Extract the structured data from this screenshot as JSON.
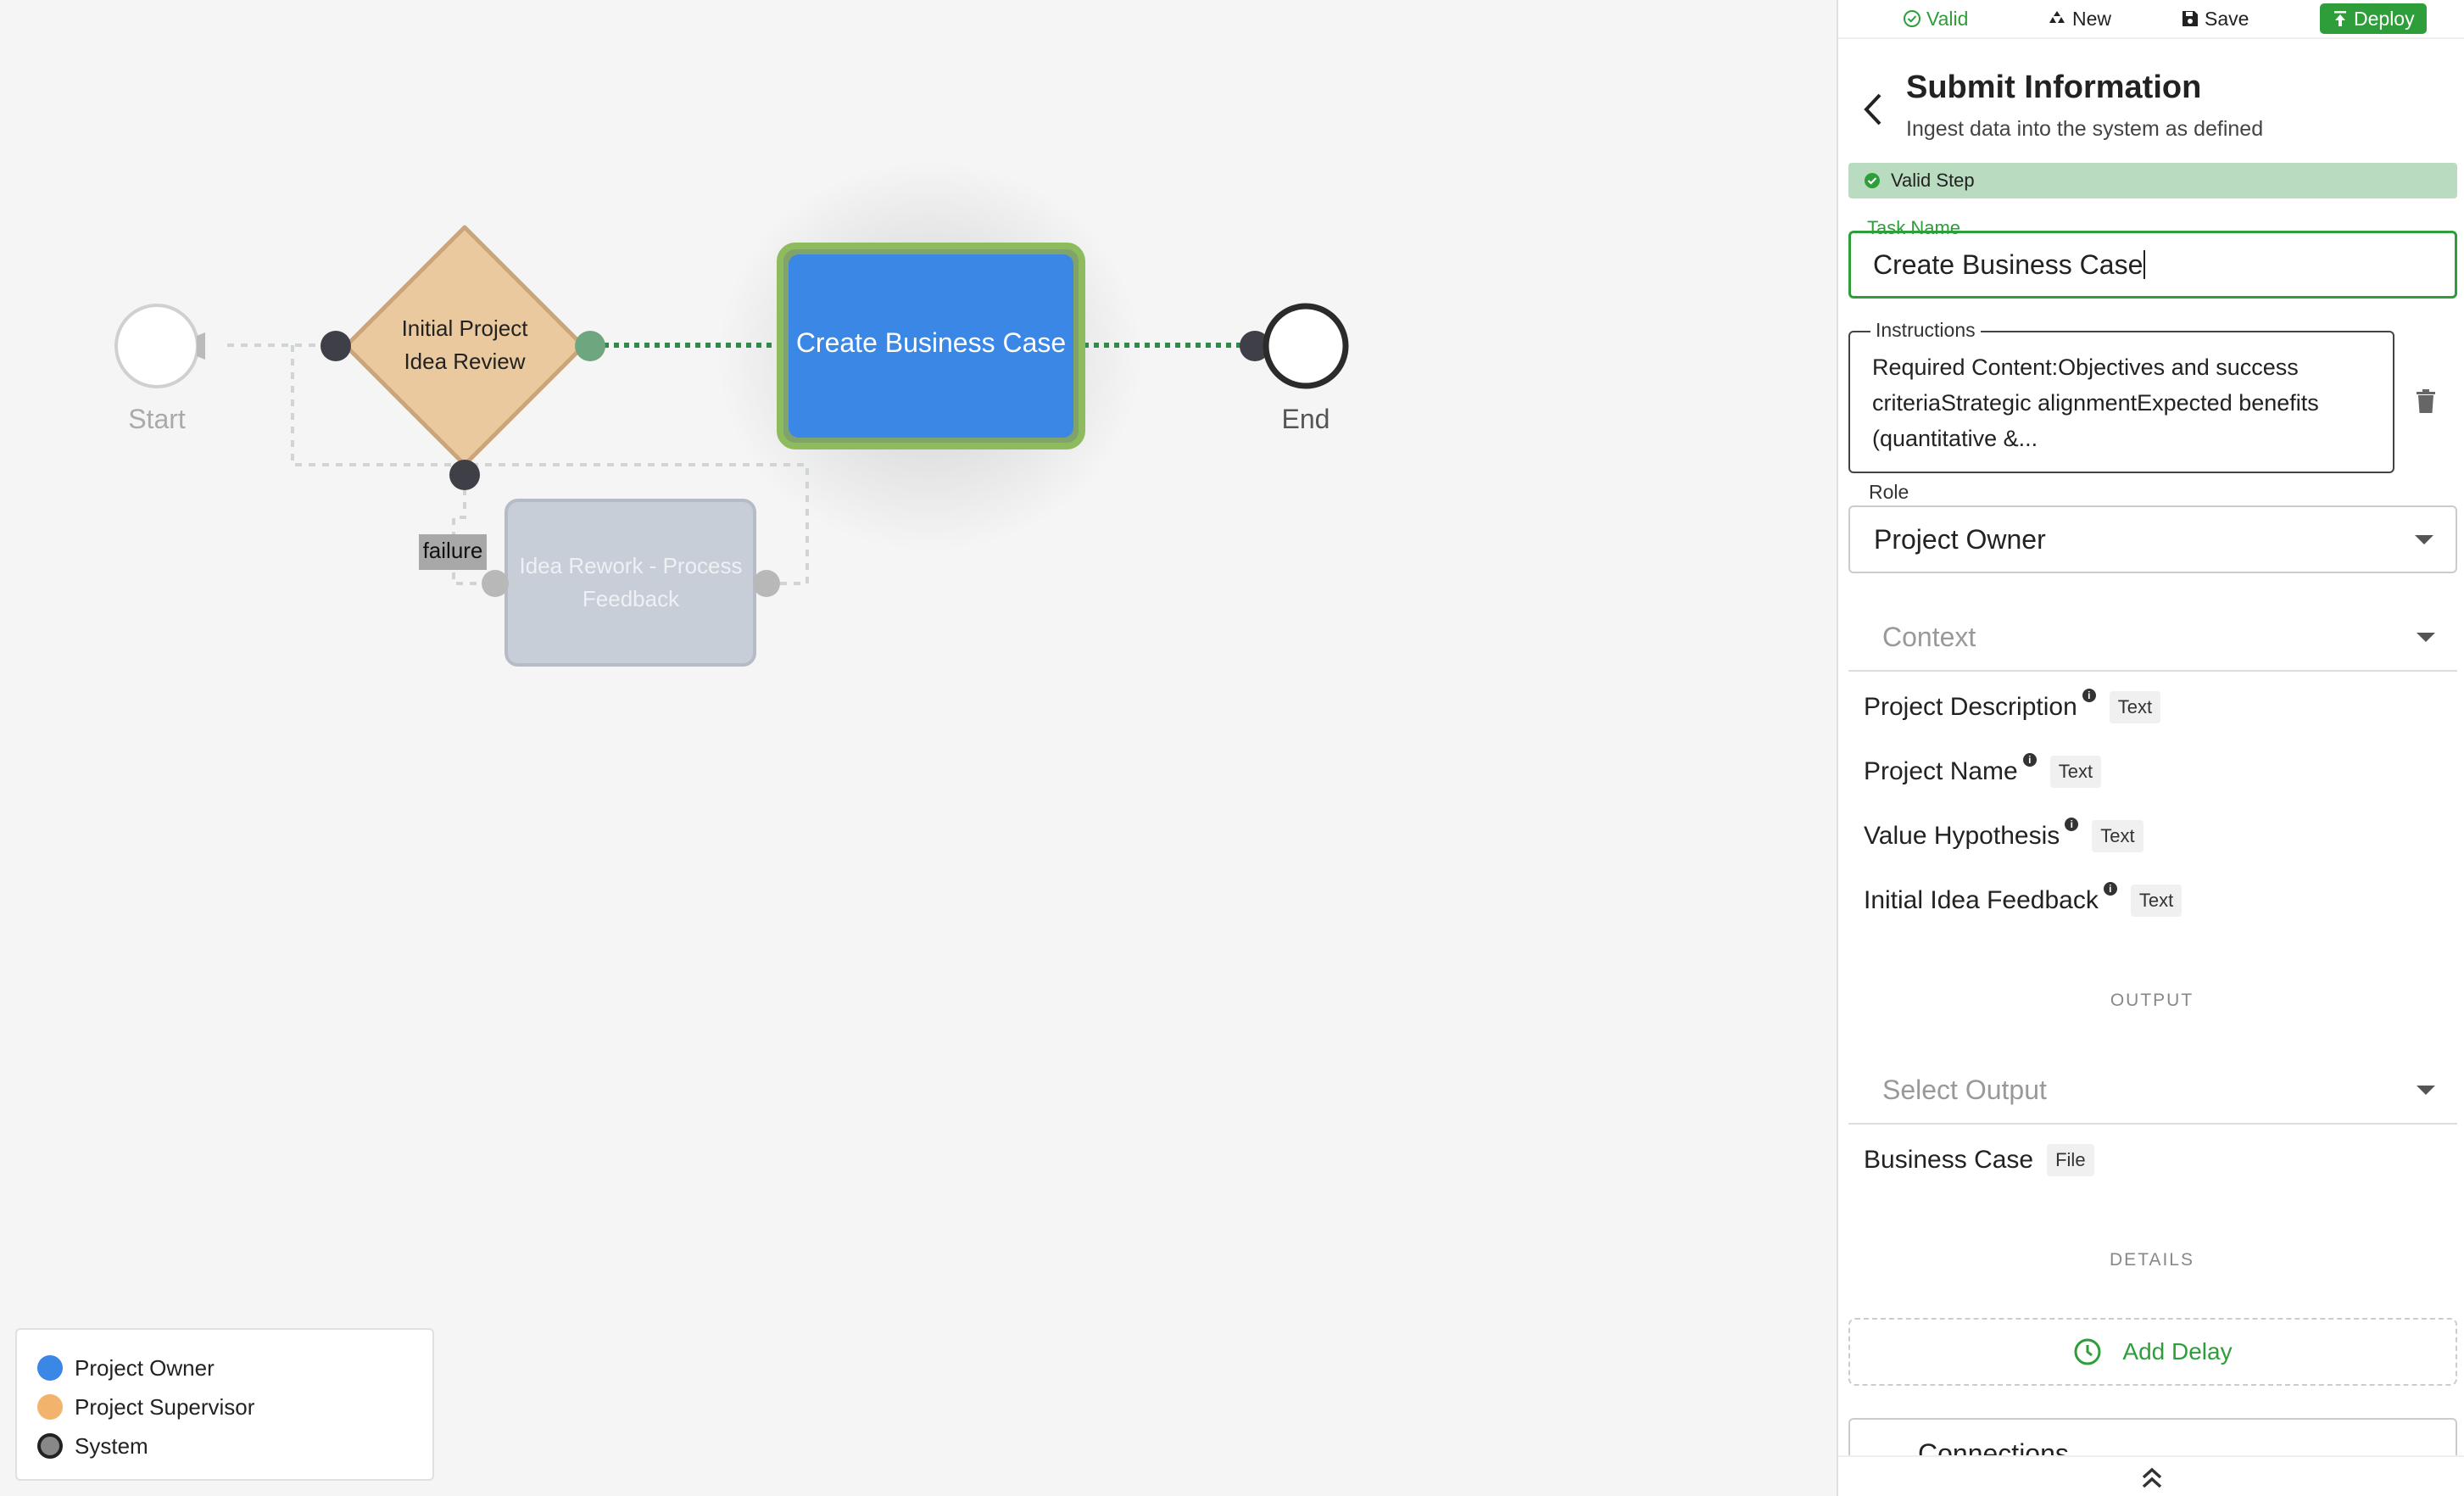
{
  "canvas": {
    "nodes": {
      "start": "Start",
      "decision_line1": "Initial Project",
      "decision_line2": "Idea Review",
      "task": "Create Business Case",
      "rework_line1": "Idea Rework - Process",
      "rework_line2": "Feedback",
      "end": "End"
    },
    "edge_label": "failure"
  },
  "legend": [
    {
      "label": "Project Owner",
      "color": "#3b87e6"
    },
    {
      "label": "Project Supervisor",
      "color": "#f2b46c"
    },
    {
      "label": "System",
      "color": "#888888"
    }
  ],
  "toolbar": {
    "valid": "Valid",
    "new": "New",
    "save": "Save",
    "deploy": "Deploy"
  },
  "panel": {
    "title": "Submit Information",
    "subtitle": "Ingest data into the system as defined",
    "status": "Valid Step",
    "task_name_label": "Task Name",
    "task_name_value": "Create Business Case",
    "instructions_label": "Instructions",
    "instructions_line1": "Required Content:Objectives and success",
    "instructions_line2": "criteriaStrategic alignmentExpected benefits",
    "instructions_line3": "(quantitative &...",
    "role_label": "Role",
    "role_value": "Project Owner",
    "context_placeholder": "Context",
    "context_items": [
      {
        "name": "Project Description",
        "type": "Text"
      },
      {
        "name": "Project Name",
        "type": "Text"
      },
      {
        "name": "Value Hypothesis",
        "type": "Text"
      },
      {
        "name": "Initial Idea Feedback",
        "type": "Text"
      }
    ],
    "output_heading": "OUTPUT",
    "output_placeholder": "Select Output",
    "output_items": [
      {
        "name": "Business Case",
        "type": "File"
      }
    ],
    "details_heading": "DETAILS",
    "add_delay": "Add Delay",
    "connections": "Connections"
  },
  "colors": {
    "accent_green": "#2e9e3b",
    "task_blue": "#3b87e6",
    "decision_orange": "#ebc99e"
  }
}
